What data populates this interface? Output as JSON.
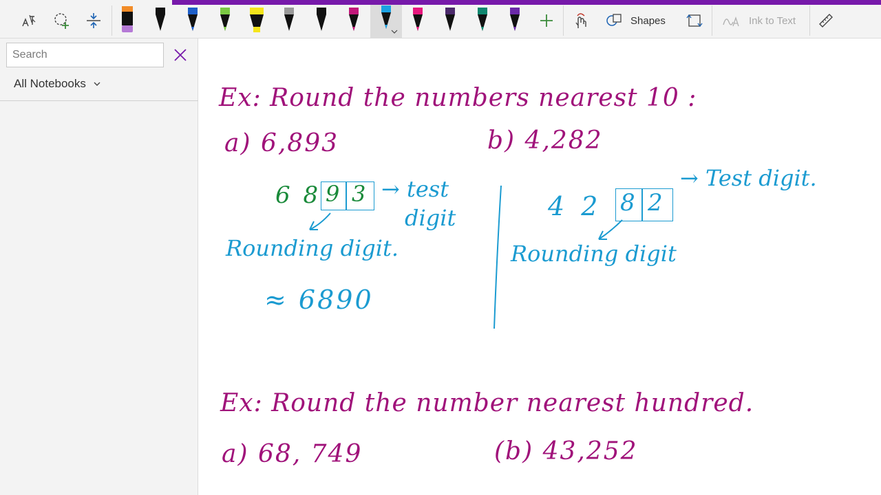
{
  "toolbar": {
    "shapes_label": "Shapes",
    "ink_to_text_label": "Ink to Text",
    "accent_color": "#7719aa",
    "pens": [
      {
        "name": "highlighter-orange",
        "color": "#f28c28"
      },
      {
        "name": "pen-black",
        "color": "#111111"
      },
      {
        "name": "pen-blue",
        "color": "#1e5fc8"
      },
      {
        "name": "pen-green",
        "color": "#7ac943"
      },
      {
        "name": "highlighter-yellow",
        "color": "#f5e51b"
      },
      {
        "name": "pen-gray-pattern",
        "color": "#7a7a7a"
      },
      {
        "name": "pen-black-2",
        "color": "#111111"
      },
      {
        "name": "pen-magenta",
        "color": "#c2187a"
      },
      {
        "name": "pen-cyan-selected",
        "color": "#1ba1e2"
      },
      {
        "name": "pen-pink",
        "color": "#e8177d"
      },
      {
        "name": "pen-dark-purple",
        "color": "#4b2a6b"
      },
      {
        "name": "pen-teal",
        "color": "#10876f"
      },
      {
        "name": "pen-purple",
        "color": "#6b2aa8"
      }
    ]
  },
  "sidebar": {
    "search_placeholder": "Search",
    "notebooks_label": "All Notebooks"
  },
  "page": {
    "ink_colors": {
      "magenta": "#a0127a",
      "cyan": "#1b9bd1",
      "green": "#1a8a3a"
    },
    "ink": {
      "ex1_title": "Ex:  Round the numbers nearest 10 :",
      "ex1_a": "a)  6,893",
      "ex1_b": "b)  4,282",
      "a_digits_68": "6 8",
      "a_digit_9": "9",
      "a_digit_3": "3",
      "a_test": "→ test",
      "a_test2": "digit",
      "a_rounding": "Rounding digit.",
      "a_result": "≈  6890",
      "b_digits_42": "4  2",
      "b_digit_8": "8",
      "b_digit_2": "2",
      "b_test": "→ Test digit.",
      "b_rounding": "Rounding digit",
      "ex2_title": "Ex:  Round the number nearest hundred.",
      "ex2_a": "a)  68, 749",
      "ex2_b": "(b)   43,252"
    }
  }
}
